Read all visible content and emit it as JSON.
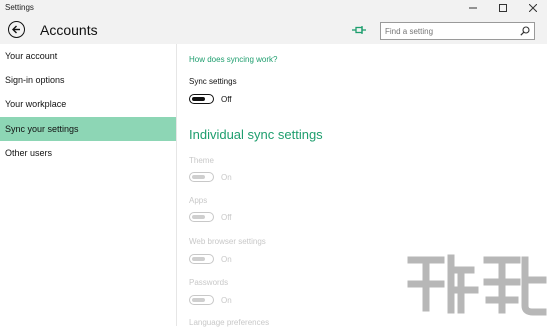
{
  "window": {
    "title": "Settings"
  },
  "header": {
    "title": "Accounts"
  },
  "search": {
    "placeholder": "Find a setting"
  },
  "sidebar": {
    "items": [
      {
        "label": "Your account"
      },
      {
        "label": "Sign-in options"
      },
      {
        "label": "Your workplace"
      },
      {
        "label": "Sync your settings",
        "active": true
      },
      {
        "label": "Other users"
      }
    ]
  },
  "main": {
    "help_link": "How does syncing work?",
    "sync_label": "Sync settings",
    "sync_state": "Off",
    "section_title": "Individual sync settings",
    "items": [
      {
        "label": "Theme",
        "state": "On"
      },
      {
        "label": "Apps",
        "state": "Off"
      },
      {
        "label": "Web browser settings",
        "state": "On"
      },
      {
        "label": "Passwords",
        "state": "On"
      },
      {
        "label": "Language preferences"
      }
    ]
  },
  "colors": {
    "accent": "#1e9e6e",
    "selected_nav": "#8dd6b5",
    "chrome": "#f2f2f2",
    "disabled": "#c8c8c8"
  },
  "icons": {
    "back": "back-arrow-icon",
    "pin": "pin-icon",
    "search": "search-icon",
    "minimize": "minimize-icon",
    "maximize": "maximize-icon",
    "close": "close-icon"
  }
}
